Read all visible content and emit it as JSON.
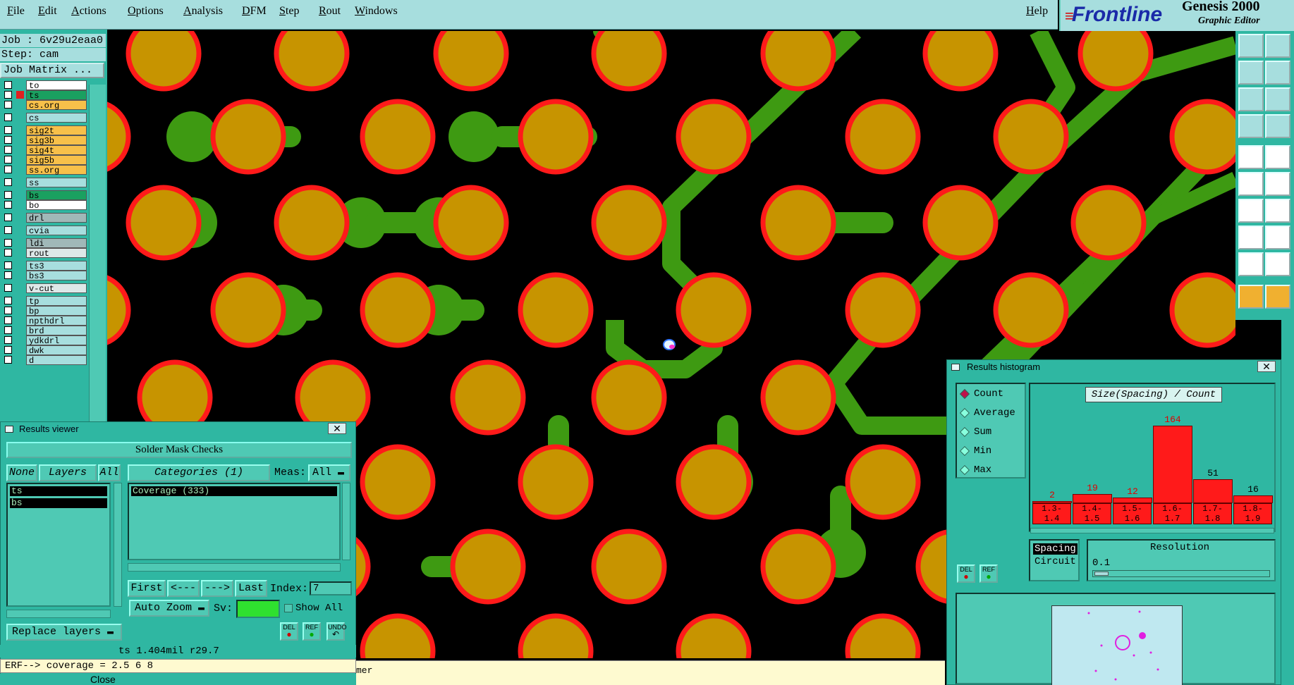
{
  "menu": {
    "items": [
      "File",
      "Edit",
      "Actions",
      "Options",
      "Analysis",
      "DFM",
      "Step",
      "Rout",
      "Windows"
    ],
    "help": "Help"
  },
  "brand": {
    "logo": "Frontline",
    "title": "Genesis 2000",
    "subtitle": "Graphic Editor"
  },
  "job": {
    "job_line": "Job : 6v29u2eaa0",
    "step_line": "Step: cam",
    "matrix_button": "Job Matrix ..."
  },
  "layers": [
    {
      "name": "to",
      "color": "#ffffff"
    },
    {
      "name": "ts",
      "color": "#1aa060"
    },
    {
      "name": "cs.org",
      "color": "#f7c04a"
    },
    {
      "name": "cs",
      "color": "#a7dede"
    },
    {
      "name": "sig2t",
      "color": "#f7c04a"
    },
    {
      "name": "sig3b",
      "color": "#f7c04a"
    },
    {
      "name": "sig4t",
      "color": "#f7c04a"
    },
    {
      "name": "sig5b",
      "color": "#f7c04a"
    },
    {
      "name": "ss.org",
      "color": "#f7c04a"
    },
    {
      "name": "ss",
      "color": "#a7dede"
    },
    {
      "name": "bs",
      "color": "#1aa060"
    },
    {
      "name": "bo",
      "color": "#ffffff"
    },
    {
      "name": "drl",
      "color": "#a0b8b8"
    },
    {
      "name": "cvia",
      "color": "#a7dede"
    },
    {
      "name": "ldi",
      "color": "#a0b8b8"
    },
    {
      "name": "rout",
      "color": "#dde8e8"
    },
    {
      "name": "ts3",
      "color": "#a7dede"
    },
    {
      "name": "bs3",
      "color": "#a7dede"
    },
    {
      "name": "v-cut",
      "color": "#dde8e8"
    },
    {
      "name": "tp",
      "color": "#a7dede"
    },
    {
      "name": "bp",
      "color": "#a7dede"
    },
    {
      "name": "npthdrl",
      "color": "#a7dede"
    },
    {
      "name": "brd",
      "color": "#a7dede"
    },
    {
      "name": "ydkdrl",
      "color": "#a7dede"
    },
    {
      "name": "dwk",
      "color": "#a7dede"
    },
    {
      "name": "d",
      "color": "#a7dede"
    }
  ],
  "results_viewer": {
    "title": "Results viewer",
    "header": "Solder Mask Checks",
    "none_btn": "None",
    "layers_btn": "Layers",
    "all_btn": "All",
    "categories_btn": "Categories (1)",
    "meas_label": "Meas:",
    "meas_value": "All",
    "layer_list": [
      "ts",
      "bs"
    ],
    "category_list": [
      "Coverage (333)"
    ],
    "first_btn": "First",
    "prev_btn": "<---",
    "next_btn": "--->",
    "last_btn": "Last",
    "index_label": "Index:",
    "index_value": "7",
    "zoom_value": "Auto Zoom",
    "sv_label": "Sv:",
    "show_all_label": "Show All",
    "replace_value": "Replace layers",
    "del_label": "DEL",
    "ref_label": "REF",
    "undo_label": "UNDO",
    "status_line": "ts 1.404mil  r29.7",
    "erf_line": "ERF--> coverage = 2.5 6 8",
    "close_label": "Close"
  },
  "status_strip": {
    "text": "mer"
  },
  "histogram": {
    "title": "Results histogram",
    "modes": [
      "Count",
      "Average",
      "Sum",
      "Min",
      "Max"
    ],
    "selected_mode": "Count",
    "plot_title": "Size(Spacing) / Count",
    "del_label": "DEL",
    "ref_label": "REF",
    "type_options": [
      "Spacing",
      "Circuit"
    ],
    "selected_type": "Spacing",
    "resolution_label": "Resolution",
    "resolution_value": "0.1"
  },
  "chart_data": {
    "type": "bar",
    "title": "Size(Spacing) / Count",
    "categories": [
      "1.3-1.4",
      "1.4-1.5",
      "1.5-1.6",
      "1.6-1.7",
      "1.7-1.8",
      "1.8-1.9"
    ],
    "values": [
      2,
      19,
      12,
      164,
      51,
      16
    ],
    "ylim": [
      0,
      164
    ],
    "label_colors": [
      "#e00000",
      "#e00000",
      "#e00000",
      "#e00000",
      "#000000",
      "#000000"
    ]
  },
  "colors": {
    "pad": "#c79400",
    "pad_ring": "#ff1a1a",
    "trace": "#3e9a12",
    "ui_teal": "#2fb7a2",
    "ui_light": "#a7dede"
  }
}
